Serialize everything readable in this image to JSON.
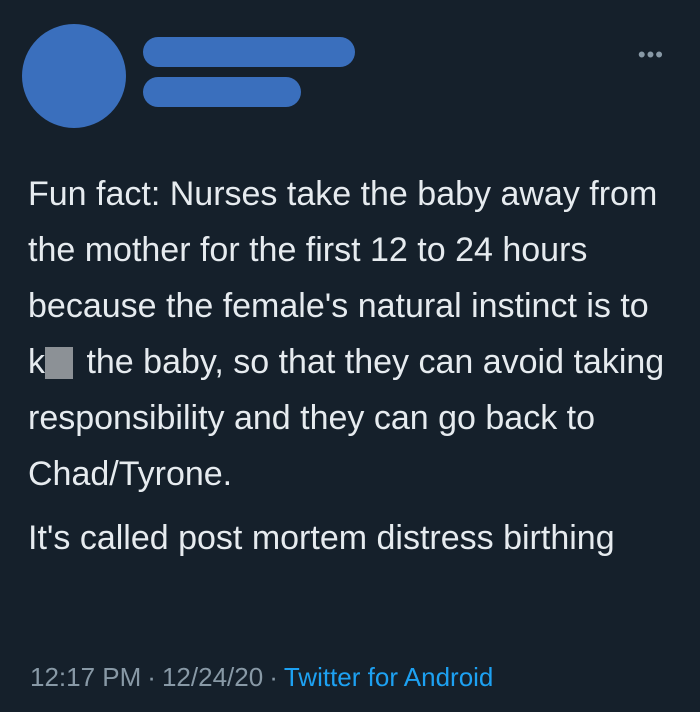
{
  "tweet": {
    "more_glyph": "•••",
    "paragraph1": {
      "before_redaction": "Fun fact: Nurses take the baby away from the mother for the first 12 to 24 hours because the female's natural instinct is to k",
      "after_redaction": " the baby, so that they can avoid taking responsibility and they can go back to Chad/Tyrone."
    },
    "paragraph2": "It's called post mortem distress birthing",
    "meta": {
      "time": "12:17 PM",
      "separator": "·",
      "date": "12/24/20",
      "source": "Twitter for Android"
    }
  },
  "colors": {
    "background": "#15202b",
    "censor_bars": "#3a6fbd",
    "text": "#e6ebef",
    "muted": "#8899a6",
    "link": "#1da1f2",
    "redaction": "#8c9196"
  },
  "icons": {
    "more": "more-options-icon"
  }
}
